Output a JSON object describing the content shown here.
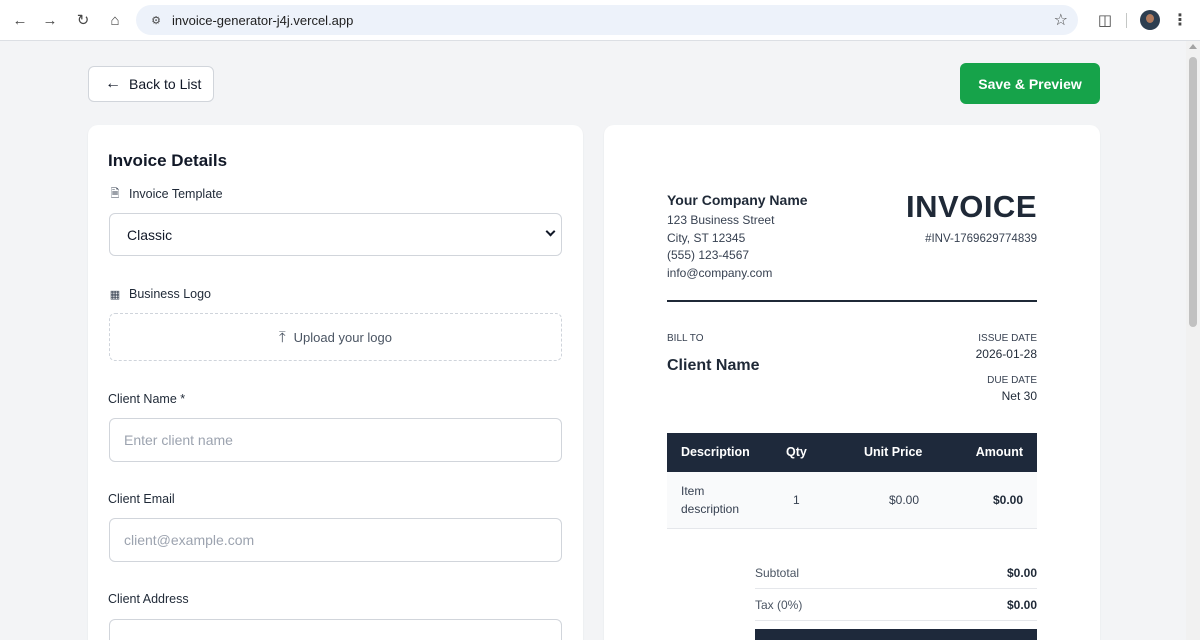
{
  "browser": {
    "url": "invoice-generator-j4j.vercel.app",
    "icons": [
      "back-icon",
      "forward-icon",
      "reload-icon",
      "home-icon",
      "site-info-icon",
      "star-icon",
      "extensions-icon",
      "profile-avatar",
      "menu-icon"
    ]
  },
  "toolbar": {
    "back_label": "Back to List",
    "save_label": "Save & Preview",
    "save_color": "#16a34a"
  },
  "form": {
    "title": "Invoice Details",
    "template_label": "Invoice Template",
    "template_value": "Classic",
    "logo_label": "Business Logo",
    "upload_label": "Upload your logo",
    "client_name_label": "Client Name *",
    "client_name_placeholder": "Enter client name",
    "client_email_label": "Client Email",
    "client_email_placeholder": "client@example.com",
    "client_address_label": "Client Address"
  },
  "preview": {
    "company_name": "Your Company Name",
    "company_lines": [
      "123 Business Street",
      "City, ST 12345",
      "(555) 123-4567",
      "info@company.com"
    ],
    "title": "INVOICE",
    "invoice_number": "#INV-1769629774839",
    "bill_to_label": "BILL TO",
    "client_name": "Client Name",
    "issue_date_label": "ISSUE DATE",
    "issue_date": "2026-01-28",
    "due_date_label": "DUE DATE",
    "due_date": "Net 30",
    "table": {
      "headers": [
        "Description",
        "Qty",
        "Unit Price",
        "Amount"
      ],
      "rows": [
        {
          "description_1": "Item",
          "description_2": "description",
          "qty": "1",
          "unit_price": "$0.00",
          "amount": "$0.00"
        }
      ]
    },
    "subtotal_label": "Subtotal",
    "subtotal": "$0.00",
    "tax_label": "Tax (0%)",
    "tax": "$0.00",
    "header_color": "#1e293b"
  }
}
